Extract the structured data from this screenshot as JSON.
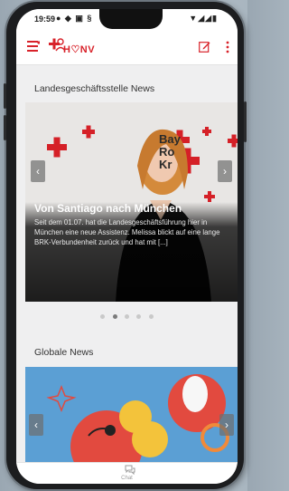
{
  "status_bar": {
    "time": "19:59",
    "left_icons": "● ◆ ▣ §",
    "right_icons": "▼◢◢▮"
  },
  "app_bar": {
    "logo_text": "H♡NV",
    "accent_color": "#d8222a"
  },
  "sections": {
    "landes": {
      "title": "Landesgeschäftsstelle News",
      "article": {
        "headline": "Von Santiago nach München",
        "text": "Seit dem 01.07. hat die Landesgeschäftsführung hier in München eine neue Assistenz. Melissa blickt auf eine lange BRK-Verbundenheit zurück und hat mit [...]",
        "backdrop_text": [
          "Bay",
          "Ro",
          "Kr"
        ]
      },
      "carousel": {
        "slide_count": 5,
        "active_index": 1,
        "prev_icon": "‹",
        "next_icon": "›"
      }
    },
    "global": {
      "title": "Globale News",
      "prev_icon": "‹",
      "next_icon": "›"
    }
  },
  "bottom_nav": {
    "chat_label": "Chat"
  }
}
